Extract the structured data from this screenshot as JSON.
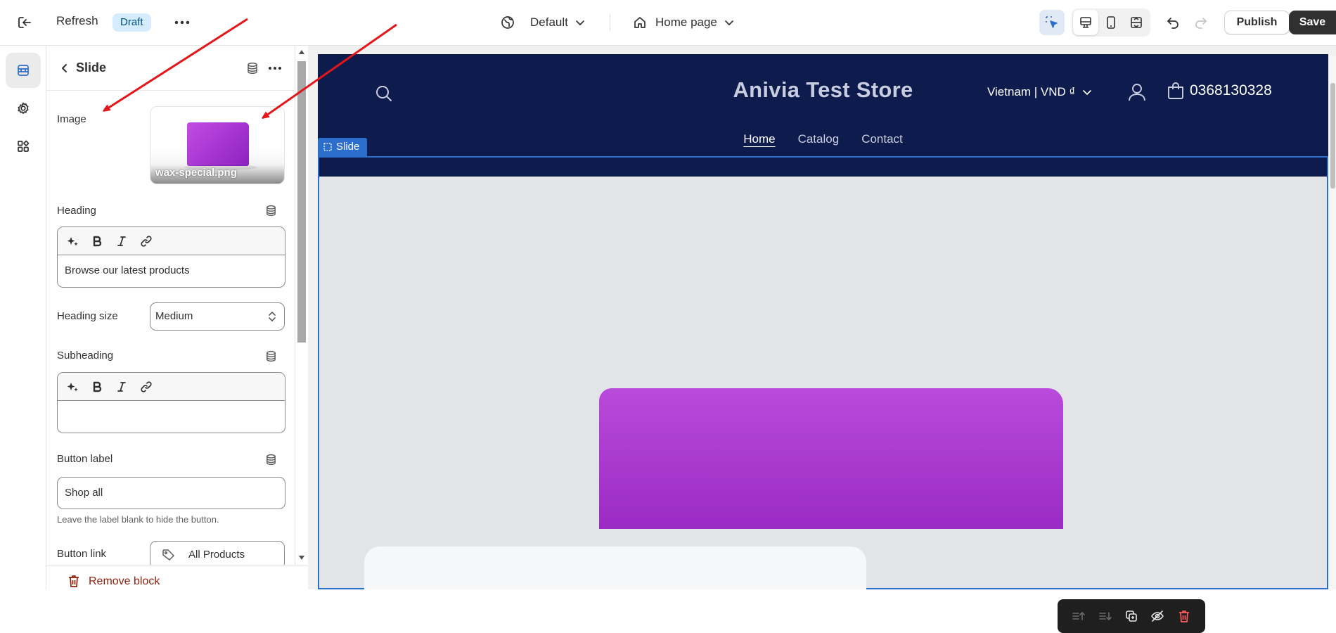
{
  "topbar": {
    "title": "Refresh",
    "status_badge": "Draft",
    "theme_selector": "Default",
    "page_selector": "Home page",
    "publish_label": "Publish",
    "save_label": "Save"
  },
  "rail": {
    "items": [
      "sections-icon",
      "settings-icon",
      "apps-icon"
    ]
  },
  "panel": {
    "title": "Slide",
    "image": {
      "label": "Image",
      "filename": "wax-special.png"
    },
    "heading": {
      "label": "Heading",
      "value": "Browse our latest products"
    },
    "heading_size": {
      "label": "Heading size",
      "value": "Medium"
    },
    "subheading": {
      "label": "Subheading",
      "value": ""
    },
    "button_label": {
      "label": "Button label",
      "value": "Shop all",
      "hint": "Leave the label blank to hide the button."
    },
    "button_link": {
      "label": "Button link",
      "value": "All Products"
    },
    "remove_label": "Remove block"
  },
  "preview": {
    "store_name": "Anivia Test Store",
    "country": "Vietnam | VND ₫",
    "cart_phone": "0368130328",
    "nav": [
      "Home",
      "Catalog",
      "Contact"
    ],
    "selected_block_tag": "Slide"
  },
  "colors": {
    "store_header": "#0e1b4d",
    "selection_blue": "#2c6ecb",
    "wax_purple": "#a436d1",
    "annotation_red": "#e3161b"
  }
}
